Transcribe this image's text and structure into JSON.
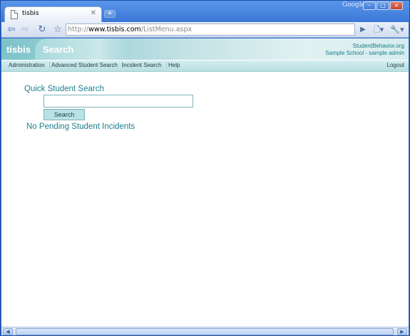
{
  "browser": {
    "brand": "Google",
    "tab_title": "tisbis",
    "url_scheme": "http://",
    "url_host": "www.tisbis.com",
    "url_path": "/ListMenu.aspx",
    "window_buttons": {
      "minimize": "–",
      "maximize": "□",
      "close": "×"
    }
  },
  "header": {
    "logo": "tisbis",
    "page_title": "Search",
    "site_link": "StudentBehavior.org",
    "user_text": "Sample School - sample admin"
  },
  "menu": {
    "items": [
      "Administration",
      "Advanced Student Search",
      "Incident Search",
      "Help"
    ],
    "logout": "Logout"
  },
  "main": {
    "quick_search_title": "Quick Student Search",
    "search_input_value": "",
    "search_button": "Search",
    "pending_text": "No Pending Student Incidents"
  },
  "colors": {
    "accent": "#1d7f8c",
    "header_light": "#e2f1f2",
    "header_dark": "#7cc3c9",
    "button_bg": "#b9e2e5"
  }
}
